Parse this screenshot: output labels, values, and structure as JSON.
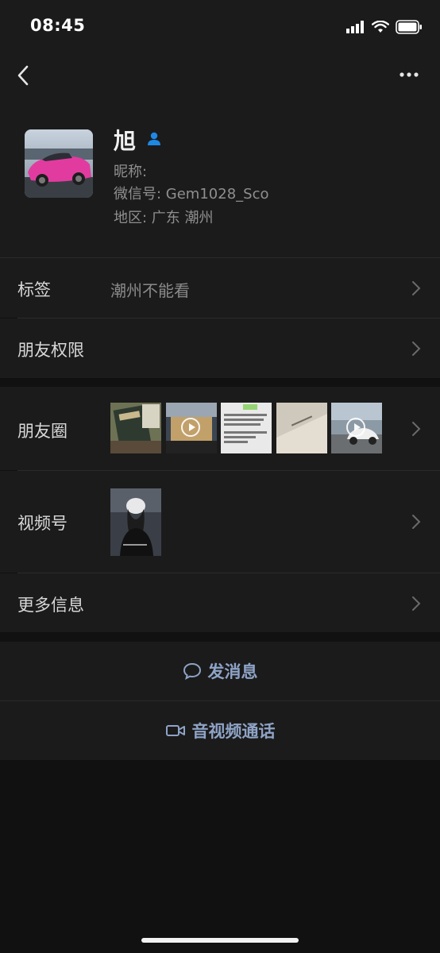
{
  "status_bar": {
    "time": "08:45"
  },
  "profile": {
    "name": "旭",
    "nickname_label": "昵称:",
    "wechat_id_label": "微信号: Gem1028_Sco",
    "region_label": "地区: 广东 潮州"
  },
  "rows": {
    "tags": {
      "label": "标签",
      "value": "潮州不能看"
    },
    "friend_permissions": {
      "label": "朋友权限"
    },
    "moments": {
      "label": "朋友圈"
    },
    "channels": {
      "label": "视频号"
    },
    "more_info": {
      "label": "更多信息"
    }
  },
  "actions": {
    "send_message": "发消息",
    "av_call": "音视频通话"
  },
  "colors": {
    "background": "#111111",
    "panel": "#1b1b1b",
    "accent_blue": "#8ea3c6",
    "person_badge": "#1e88e5"
  },
  "icons": {
    "back": "chevron-left-icon",
    "more": "more-dots-icon",
    "person": "person-badge-icon",
    "chevron": "chevron-right-icon",
    "message": "chat-bubble-icon",
    "video": "video-camera-icon"
  }
}
